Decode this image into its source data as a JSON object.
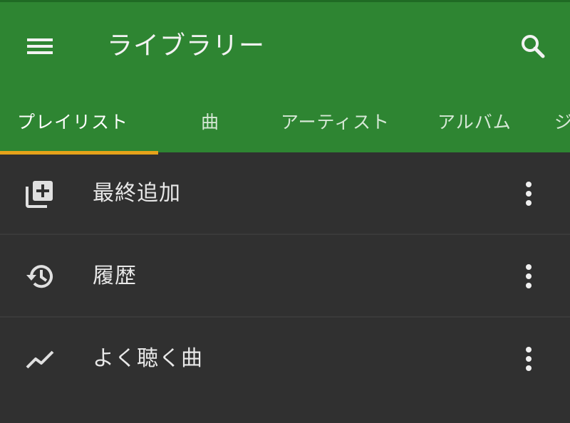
{
  "appbar": {
    "title": "ライブラリー",
    "menu_icon": "menu-icon",
    "search_icon": "search-icon",
    "color": "#2e8532"
  },
  "tabs": [
    {
      "label": "プレイリスト",
      "active": true
    },
    {
      "label": "曲",
      "active": false
    },
    {
      "label": "アーティスト",
      "active": false
    },
    {
      "label": "アルバム",
      "active": false
    },
    {
      "label": "ジ",
      "active": false
    }
  ],
  "tab_indicator_color": "#e6a21a",
  "playlists": [
    {
      "label": "最終追加",
      "icon": "library-add-icon"
    },
    {
      "label": "履歴",
      "icon": "history-icon"
    },
    {
      "label": "よく聴く曲",
      "icon": "trending-up-icon"
    }
  ],
  "more_icon": "more-vert-icon"
}
